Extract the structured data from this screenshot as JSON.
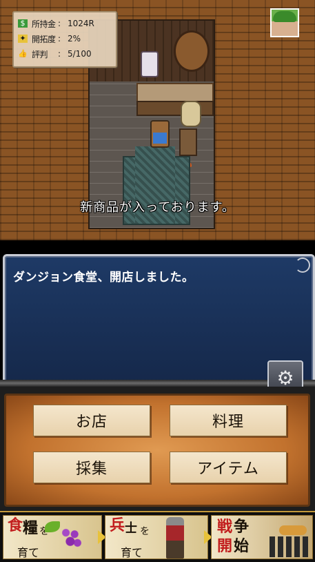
{
  "status": {
    "money": {
      "icon": "money-icon",
      "label": "所持金",
      "sep": ":",
      "value": "1024R"
    },
    "development": {
      "icon": "map-icon",
      "label": "開拓度",
      "sep": ":",
      "value": "2%"
    },
    "reputation": {
      "icon": "thumbs-up-icon",
      "label": "評判",
      "sep": ":",
      "value": "5/100"
    }
  },
  "notice_text": "新商品が入っております。",
  "message": {
    "text": "ダンジョン食堂、開店しました。"
  },
  "menu": {
    "shop": "お店",
    "cook": "料理",
    "gather": "採集",
    "item": "アイテム"
  },
  "banner": {
    "step1": {
      "big1": "食",
      "big2": "糧",
      "small1": "を",
      "small2": "育て"
    },
    "step2": {
      "big": "兵",
      "mid": "士",
      "small1": "を",
      "small2": "育て"
    },
    "step3": {
      "big1": "戦",
      "big2": "争",
      "big3": "開",
      "big4": "始"
    }
  },
  "colors": {
    "message_window": "#1e3a66",
    "menu_panel": "#c2722e",
    "banner_arrow": "#e8c23a"
  }
}
